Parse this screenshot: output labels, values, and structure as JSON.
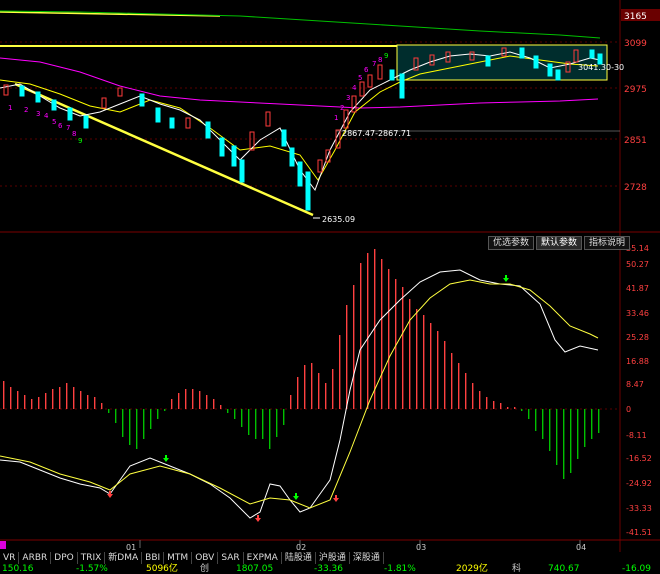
{
  "top_chart": {
    "price_axis": [
      "3165",
      "3099",
      "2975",
      "2851",
      "2728"
    ],
    "annotations": {
      "low": "2635.09",
      "range": "2867.47-2867.71",
      "right": "3041.30-30"
    },
    "td_counts_left": [
      "1",
      "2",
      "3",
      "4",
      "5",
      "6",
      "7",
      "8",
      "9"
    ],
    "td_counts_right": [
      "1",
      "2",
      "3",
      "4",
      "5",
      "6",
      "7",
      "8",
      "9"
    ]
  },
  "indicator_buttons": [
    "优选参数",
    "默认参数",
    "指标说明"
  ],
  "indicator_axis": [
    "55.14",
    "50.27",
    "41.87",
    "33.46",
    "25.28",
    "16.88",
    "8.47",
    "0",
    "-8.11",
    "-16.52",
    "-24.92",
    "-33.33",
    "-41.51"
  ],
  "month_labels": [
    "01",
    "02",
    "03",
    "04"
  ],
  "indicator_tabs": [
    "VR",
    "ARBR",
    "DPO",
    "TRIX",
    "新DMA",
    "BBI",
    "MTM",
    "OBV",
    "SAR",
    "EXPMA",
    "陆股通",
    "沪股通",
    "深股通"
  ],
  "status": {
    "s1": "150.16",
    "s2": "-1.57%",
    "s3": "5096亿",
    "s4": "创",
    "s5": "1807.05",
    "s6": "-33.36",
    "s7": "-1.81%",
    "s8": "2029亿",
    "s9": "科",
    "s10": "740.67",
    "s11": "-16.09"
  },
  "colors": {
    "up": "#ff3b3b",
    "down": "#00ffff",
    "ma5": "#ffffff",
    "ma10": "#ffff00",
    "ma20": "#ff00ff",
    "ma60": "#00c000",
    "trend": "#ffff40",
    "macd_up": "#ff4040",
    "macd_down": "#00c000"
  }
}
